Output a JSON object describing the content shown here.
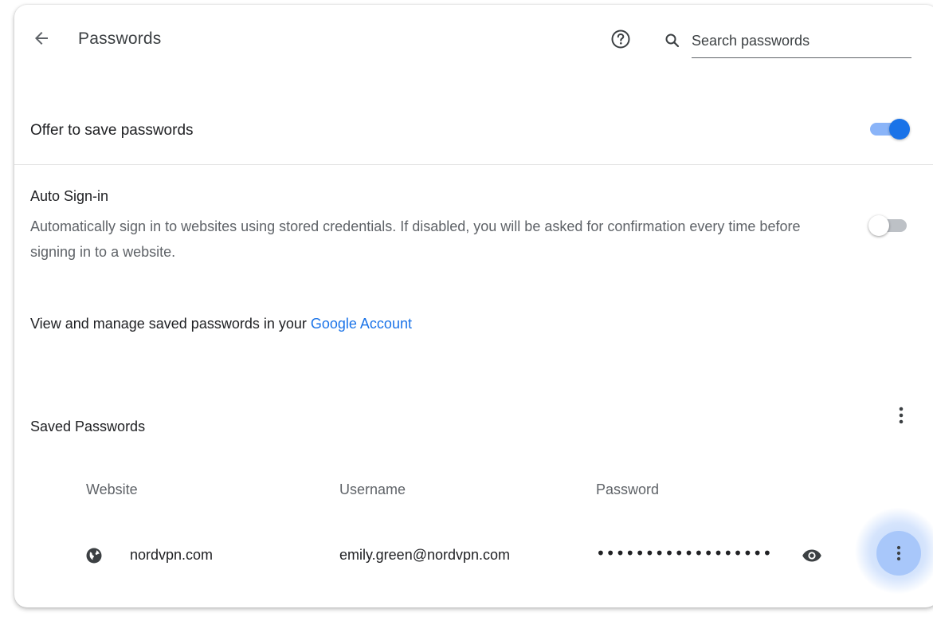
{
  "header": {
    "title": "Passwords",
    "back_icon": "arrow-back-icon",
    "help_icon": "help-circle-icon",
    "search": {
      "placeholder": "Search passwords",
      "value": ""
    }
  },
  "settings": {
    "offer_to_save": {
      "label": "Offer to save passwords",
      "enabled": true
    },
    "auto_signin": {
      "title": "Auto Sign-in",
      "description": "Automatically sign in to websites using stored credentials. If disabled, you will be asked for confirmation every time before signing in to a website.",
      "enabled": false
    },
    "manage": {
      "prefix": "View and manage saved passwords in your ",
      "link_text": "Google Account"
    }
  },
  "saved_passwords": {
    "title": "Saved Passwords",
    "columns": {
      "website": "Website",
      "username": "Username",
      "password": "Password"
    },
    "entries": [
      {
        "website": "nordvpn.com",
        "username": "emily.green@nordvpn.com",
        "password_masked": "••••••••••••••••••"
      }
    ]
  },
  "colors": {
    "accent": "#1a73e8",
    "toggle_track_on": "#8ab4f8",
    "highlight": "#a8c7fa"
  }
}
